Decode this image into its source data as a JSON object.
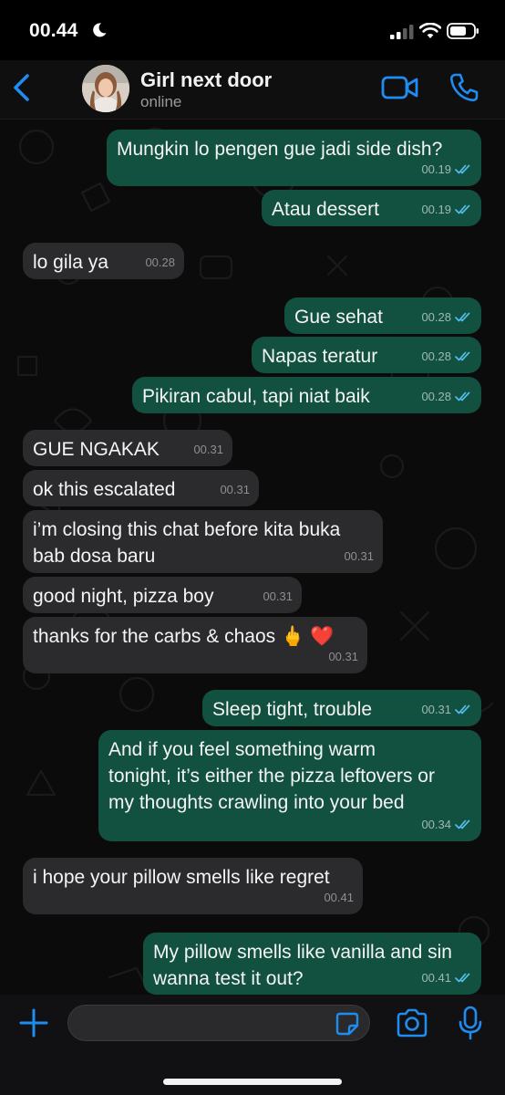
{
  "status_bar": {
    "time": "00.44"
  },
  "header": {
    "contact_name": "Girl next door",
    "contact_status": "online"
  },
  "colors": {
    "accent": "#1f8cf0",
    "outgoing_bubble": "#12513f",
    "incoming_bubble": "#2b2b2d",
    "read_ticks": "#53bdeb"
  },
  "messages": [
    {
      "dir": "out",
      "text": "Mungkin lo pengen gue jadi side dish?",
      "time": "00.19",
      "read": true
    },
    {
      "dir": "out",
      "text": "Atau dessert",
      "time": "00.19",
      "read": true
    },
    {
      "dir": "in",
      "text": "lo gila ya",
      "time": "00.28"
    },
    {
      "dir": "out",
      "text": "Gue sehat",
      "time": "00.28",
      "read": true
    },
    {
      "dir": "out",
      "text": "Napas teratur",
      "time": "00.28",
      "read": true
    },
    {
      "dir": "out",
      "text": "Pikiran cabul, tapi niat baik",
      "time": "00.28",
      "read": true
    },
    {
      "dir": "in",
      "text": "GUE NGAKAK",
      "time": "00.31"
    },
    {
      "dir": "in",
      "text": "ok this escalated",
      "time": "00.31"
    },
    {
      "dir": "in",
      "text": "i’m closing this chat before kita buka\nbab dosa baru",
      "time": "00.31"
    },
    {
      "dir": "in",
      "text": "good night, pizza boy",
      "time": "00.31"
    },
    {
      "dir": "in",
      "text": "thanks for the carbs & chaos 🖕 ❤️",
      "time": "00.31"
    },
    {
      "dir": "out",
      "text": "Sleep tight, trouble",
      "time": "00.31",
      "read": true
    },
    {
      "dir": "out",
      "text": "And if you feel something warm\ntonight, it’s either the pizza leftovers or\nmy thoughts crawling into your bed",
      "time": "00.34",
      "read": true
    },
    {
      "dir": "in",
      "text": "i hope your pillow smells like regret",
      "time": "00.41"
    },
    {
      "dir": "out",
      "text": "My pillow smells like vanilla and sin\nwanna test it out?",
      "time": "00.41",
      "read": true
    }
  ],
  "icons": [
    "back-chevron-icon",
    "video-call-icon",
    "phone-icon",
    "plus-icon",
    "sticker-icon",
    "camera-icon",
    "microphone-icon"
  ]
}
